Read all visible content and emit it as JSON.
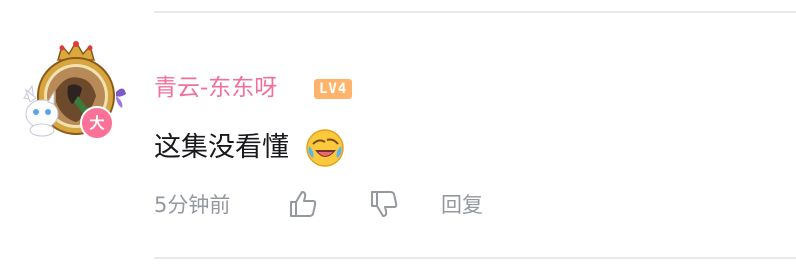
{
  "comment": {
    "username": "青云-东东呀",
    "level_badge": "LV4",
    "avatar_badge": "大",
    "text": "这集没看懂",
    "emoji": "laughing-crying-emoji",
    "timestamp": "5分钟前",
    "reply_label": "回复"
  },
  "icons": {
    "like": "thumb-up-icon",
    "dislike": "thumb-down-icon"
  },
  "colors": {
    "username": "#f0709a",
    "level_badge": "#ffb36b",
    "avatar_badge": "#fb7299",
    "text": "#18191c",
    "meta": "#9499a0",
    "divider": "#e9e9ec"
  }
}
